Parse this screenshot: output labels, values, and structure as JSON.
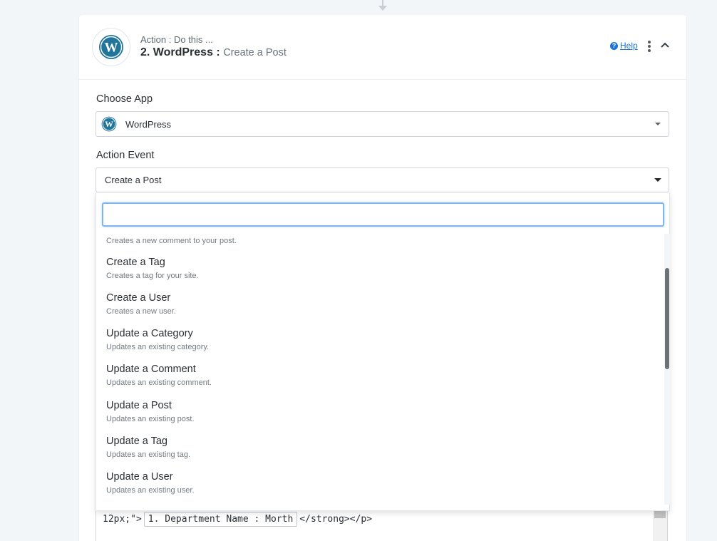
{
  "header": {
    "subtitle": "Action : Do this ...",
    "step_title": "2. WordPress :",
    "event_name": "Create a Post",
    "help_label": "Help"
  },
  "choose_app": {
    "label": "Choose App",
    "selected": "WordPress"
  },
  "action_event": {
    "label": "Action Event",
    "selected": "Create a Post"
  },
  "dropdown": {
    "search_value": "",
    "partial_description": "Creates a new comment to your post.",
    "items": [
      {
        "title": "Create a Tag",
        "description": "Creates a tag for your site."
      },
      {
        "title": "Create a User",
        "description": "Creates a new user."
      },
      {
        "title": "Update a Category",
        "description": "Updates an existing category."
      },
      {
        "title": "Update a Comment",
        "description": "Updates an existing comment."
      },
      {
        "title": "Update a Post",
        "description": "Updates an existing post."
      },
      {
        "title": "Update a Tag",
        "description": "Updates an existing tag."
      },
      {
        "title": "Update a User",
        "description": "Updates an existing user."
      }
    ],
    "scroll_position_fraction": 0.25
  },
  "editor": {
    "prefix": "12px;\">",
    "field_pill": "1. Department Name : Morth",
    "suffix": "</strong></p>"
  },
  "colors": {
    "accent": "#1a73d8",
    "wordpress_blue": "#21759b",
    "search_focus": "#7fb6f0"
  }
}
